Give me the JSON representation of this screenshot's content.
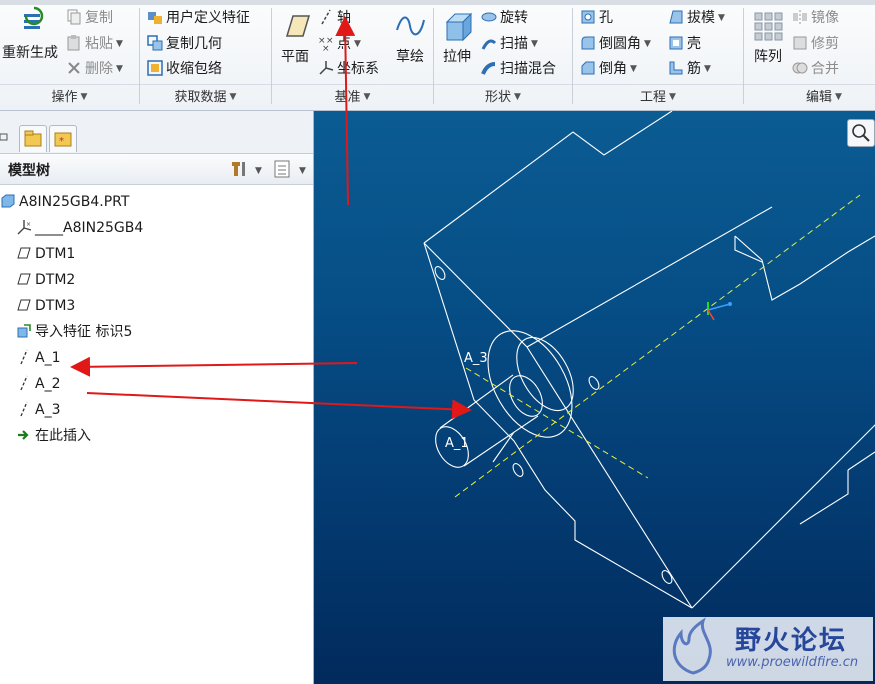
{
  "ribbon": {
    "groups": {
      "operations": "操作",
      "get_data": "获取数据",
      "datum": "基准",
      "shapes": "形状",
      "engineering": "工程",
      "editing": "编辑"
    },
    "regenerate": "重新生成",
    "copy": "复制",
    "paste": "粘贴",
    "delete": "删除",
    "user_defined_feature": "用户定义特征",
    "copy_geometry": "复制几何",
    "shrinkwrap": "收缩包络",
    "plane": "平面",
    "axis": "轴",
    "point": "点",
    "coord_system": "坐标系",
    "sketch": "草绘",
    "extrude": "拉伸",
    "revolve": "旋转",
    "sweep": "扫描",
    "swept_blend": "扫描混合",
    "hole": "孔",
    "round": "倒圆角",
    "chamfer": "倒角",
    "draft": "拔模",
    "shell": "壳",
    "rib": "筋",
    "pattern": "阵列",
    "mirror": "镜像",
    "trim": "修剪",
    "merge": "合并"
  },
  "model_tree": {
    "title": "模型树",
    "items": [
      {
        "label": "A8IN25GB4.PRT",
        "icon": "part-icon"
      },
      {
        "label": "____A8IN25GB4",
        "icon": "coordinate-system-icon"
      },
      {
        "label": "DTM1",
        "icon": "datum-plane-icon"
      },
      {
        "label": "DTM2",
        "icon": "datum-plane-icon"
      },
      {
        "label": "DTM3",
        "icon": "datum-plane-icon"
      },
      {
        "label": "导入特征 标识5",
        "icon": "import-feature-icon"
      },
      {
        "label": "A_1",
        "icon": "datum-axis-icon"
      },
      {
        "label": "A_2",
        "icon": "datum-axis-icon"
      },
      {
        "label": "A_3",
        "icon": "datum-axis-icon"
      },
      {
        "label": "在此插入",
        "icon": "insert-here-icon"
      }
    ]
  },
  "viewport": {
    "labels": {
      "a1": "A_1",
      "a3": "A_3"
    },
    "colors": {
      "wireframe": "#ffffff",
      "axis": "#e8f03c",
      "annotation_arrow": "#e01818"
    }
  },
  "watermark": {
    "title": "野火论坛",
    "url": "www.proewildfire.cn"
  }
}
